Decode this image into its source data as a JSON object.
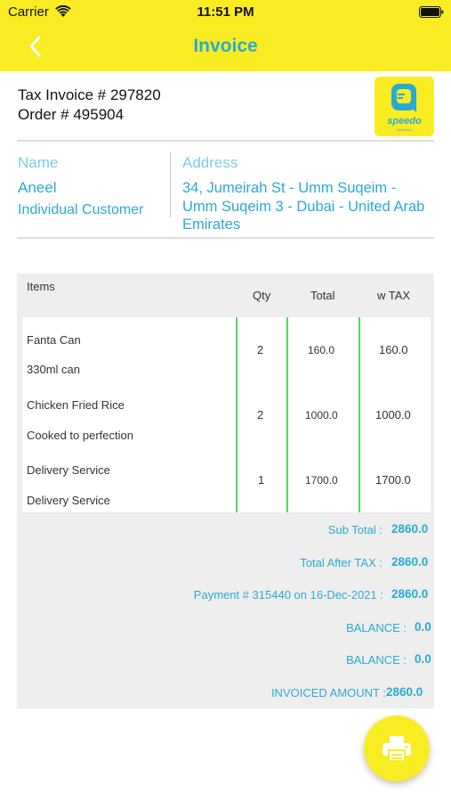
{
  "status_bar": {
    "carrier": "Carrier",
    "time": "11:51 PM"
  },
  "nav": {
    "title": "Invoice",
    "back_icon": "chevron-left-icon"
  },
  "invoice": {
    "tax_invoice": "Tax Invoice # 297820",
    "order": "Order # 495904",
    "logo_text": "speedo",
    "logo_subtext": "Merchant"
  },
  "customer": {
    "name_label": "Name",
    "name": "Aneel",
    "type": "Individual Customer",
    "address_label": "Address",
    "address": "34, Jumeirah St - Umm Suqeim - Umm Suqeim 3 - Dubai - United Arab Emirates"
  },
  "table": {
    "headers": {
      "items": "Items",
      "qty": "Qty",
      "total": "Total",
      "wtax": "w TAX"
    },
    "rows": [
      {
        "name": "Fanta Can",
        "desc": "330ml can",
        "qty": "2",
        "total": "160.0",
        "wtax": "160.0"
      },
      {
        "name": "Chicken Fried Rice",
        "desc": "Cooked to perfection",
        "qty": "2",
        "total": "1000.0",
        "wtax": "1000.0"
      },
      {
        "name": "Delivery Service",
        "desc": "Delivery Service",
        "qty": "1",
        "total": "1700.0",
        "wtax": "1700.0"
      }
    ]
  },
  "summary": {
    "sub_total_label": "Sub Total :",
    "sub_total": "2860.0",
    "total_after_tax_label": "Total After TAX :",
    "total_after_tax": "2860.0",
    "payment_label": "Payment # 315440 on 16-Dec-2021 :",
    "payment": "2860.0",
    "balance_label_1": "BALANCE :",
    "balance_1": "0.0",
    "balance_label_2": "BALANCE :",
    "balance_2": "0.0",
    "invoiced_label": "INVOICED AMOUNT :",
    "invoiced": "2860.0"
  },
  "actions": {
    "print_icon": "printer-icon"
  },
  "colors": {
    "brand_yellow": "#f9ec23",
    "accent_blue": "#2aaad2",
    "divider_green": "#4cd964"
  }
}
